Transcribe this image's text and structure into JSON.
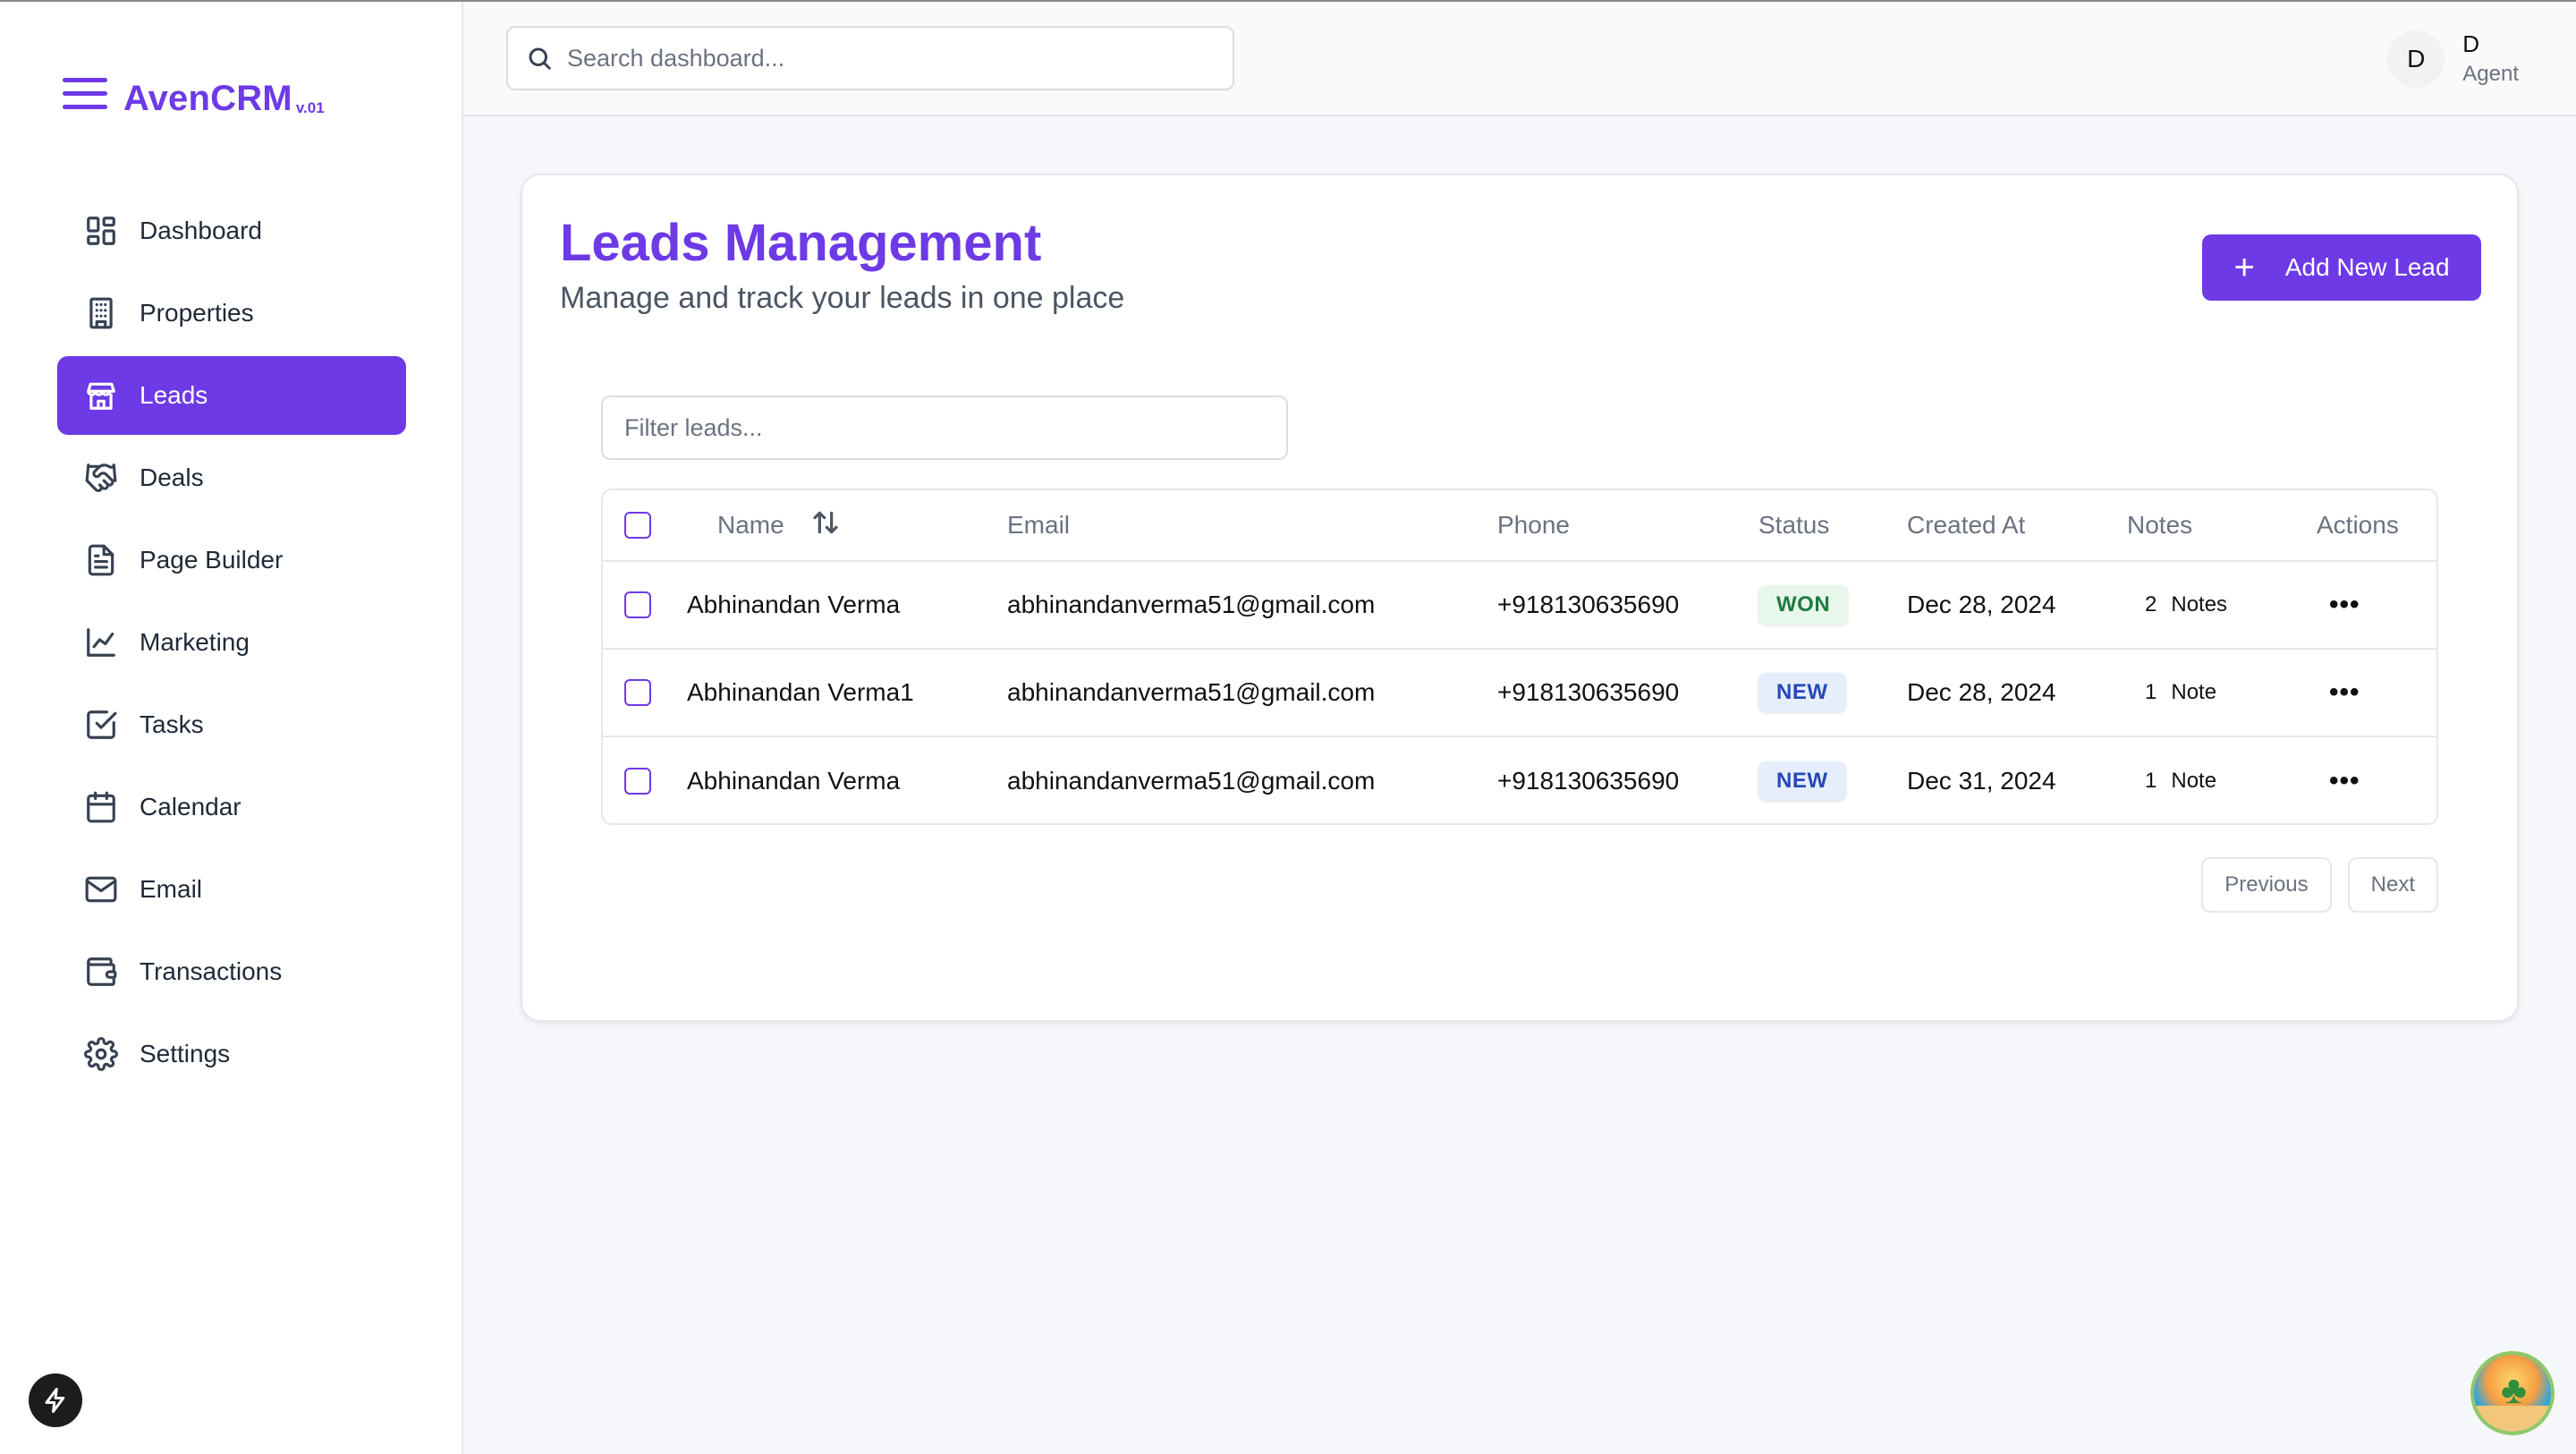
{
  "brand": {
    "name": "AvenCRM",
    "version": "v.01"
  },
  "sidebar": {
    "items": [
      {
        "label": "Dashboard",
        "icon": "grid-icon"
      },
      {
        "label": "Properties",
        "icon": "building-icon"
      },
      {
        "label": "Leads",
        "icon": "store-icon",
        "active": true
      },
      {
        "label": "Deals",
        "icon": "handshake-icon"
      },
      {
        "label": "Page Builder",
        "icon": "file-icon"
      },
      {
        "label": "Marketing",
        "icon": "chart-line-icon"
      },
      {
        "label": "Tasks",
        "icon": "check-square-icon"
      },
      {
        "label": "Calendar",
        "icon": "calendar-icon"
      },
      {
        "label": "Email",
        "icon": "mail-icon"
      },
      {
        "label": "Transactions",
        "icon": "wallet-icon"
      },
      {
        "label": "Settings",
        "icon": "gear-icon"
      }
    ]
  },
  "topbar": {
    "search_placeholder": "Search dashboard...",
    "user": {
      "initial": "D",
      "name": "D",
      "role": "Agent"
    }
  },
  "page": {
    "title": "Leads Management",
    "subtitle": "Manage and track your leads in one place",
    "add_button": "Add New Lead",
    "filter_placeholder": "Filter leads..."
  },
  "table": {
    "columns": [
      "Name",
      "Email",
      "Phone",
      "Status",
      "Created At",
      "Notes",
      "Actions"
    ],
    "rows": [
      {
        "name": "Abhinandan Verma",
        "email": "abhinandanverma51@gmail.com",
        "phone": "+918130635690",
        "status": "WON",
        "created": "Dec 28, 2024",
        "notes_count": "2",
        "notes_label": "Notes"
      },
      {
        "name": "Abhinandan Verma1",
        "email": "abhinandanverma51@gmail.com",
        "phone": "+918130635690",
        "status": "NEW",
        "created": "Dec 28, 2024",
        "notes_count": "1",
        "notes_label": "Note"
      },
      {
        "name": "Abhinandan Verma",
        "email": "abhinandanverma51@gmail.com",
        "phone": "+918130635690",
        "status": "NEW",
        "created": "Dec 31, 2024",
        "notes_count": "1",
        "notes_label": "Note"
      }
    ],
    "actions_glyph": "•••"
  },
  "pagination": {
    "previous": "Previous",
    "next": "Next"
  },
  "colors": {
    "accent": "#6d3ae6",
    "won_bg": "#e7f7ec",
    "won_text": "#1f7a3f",
    "new_bg": "#e6edfb",
    "new_text": "#2748b8"
  }
}
